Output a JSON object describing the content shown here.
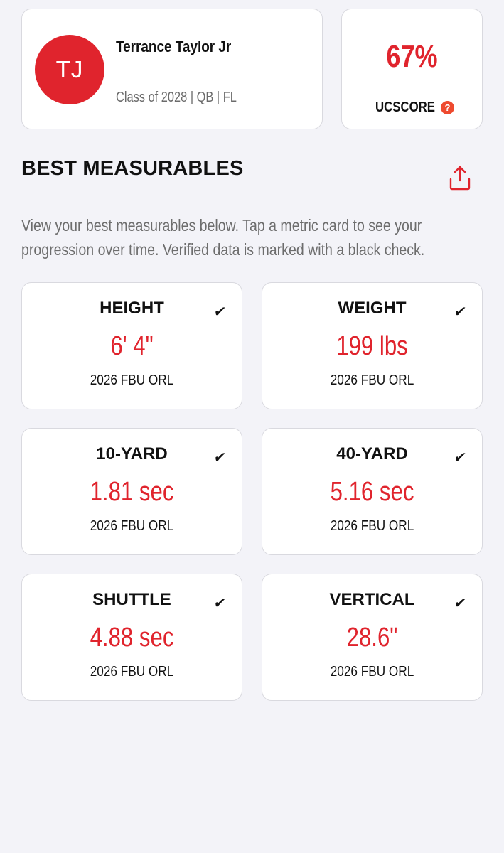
{
  "profile": {
    "initials": "TJ",
    "name": "Terrance Taylor Jr",
    "meta": "Class of 2028 | QB | FL"
  },
  "score": {
    "value": "67%",
    "label": "UCSCORE",
    "help_icon": "?"
  },
  "section": {
    "title": "BEST MEASURABLES",
    "share_icon": "share-icon",
    "description": "View your best measurables below. Tap a metric card to see your progression over time. Verified data is marked with a black check."
  },
  "metrics": [
    {
      "title": "HEIGHT",
      "value": "6' 4\"",
      "event": "2026 FBU ORL",
      "check": "✔"
    },
    {
      "title": "WEIGHT",
      "value": "199 lbs",
      "event": "2026 FBU ORL",
      "check": "✔"
    },
    {
      "title": "10-YARD",
      "value": "1.81 sec",
      "event": "2026 FBU ORL",
      "check": "✔"
    },
    {
      "title": "40-YARD",
      "value": "5.16 sec",
      "event": "2026 FBU ORL",
      "check": "✔"
    },
    {
      "title": "SHUTTLE",
      "value": "4.88 sec",
      "event": "2026 FBU ORL",
      "check": "✔"
    },
    {
      "title": "VERTICAL",
      "value": "28.6\"",
      "event": "2026 FBU ORL",
      "check": "✔"
    }
  ],
  "colors": {
    "accent": "#e0242d",
    "background": "#f3f3f8",
    "card": "#ffffff"
  }
}
